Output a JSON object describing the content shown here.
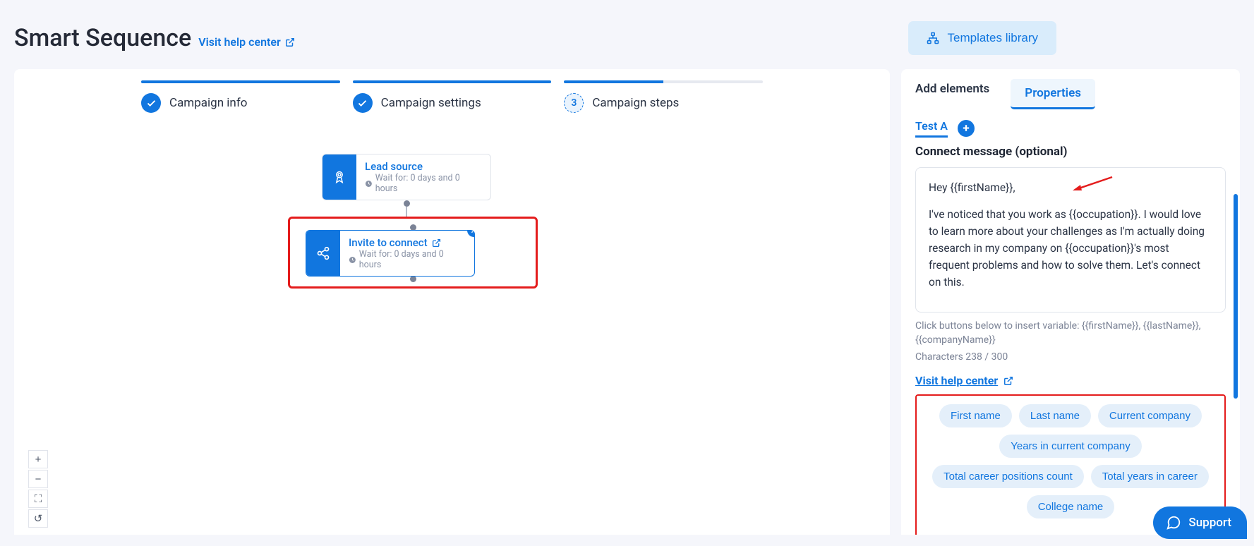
{
  "header": {
    "title": "Smart Sequence",
    "help_link": "Visit help center",
    "templates_button": "Templates library"
  },
  "steps": [
    {
      "label": "Campaign info",
      "state": "done"
    },
    {
      "label": "Campaign settings",
      "state": "done"
    },
    {
      "label": "Campaign steps",
      "state": "active",
      "number": "3"
    }
  ],
  "flow": {
    "node1": {
      "title": "Lead source",
      "sub": "Wait for: 0 days and 0 hours",
      "icon": "badge-icon"
    },
    "node2": {
      "title": "Invite to connect",
      "sub": "Wait for: 0 days and 0 hours",
      "icon": "share-icon"
    }
  },
  "zoom": {
    "in": "+",
    "out": "−",
    "fit": "⛶",
    "reset": "↺"
  },
  "panel": {
    "tabs": {
      "add": "Add elements",
      "properties": "Properties"
    },
    "test_label": "Test A",
    "section_title": "Connect message (optional)",
    "message_line1": "Hey {{firstName}},",
    "message_body": "I've noticed that you work as {{occupation}}. I would love to learn more about your challenges as I'm actually doing research in my company on {{occupation}}'s most frequent problems and how to solve them. Let's connect on this.",
    "hint": "Click buttons below to insert variable: {{firstName}}, {{lastName}}, {{companyName}}",
    "counter": "Characters 238 / 300",
    "help_link": "Visit help center",
    "chips": [
      "First name",
      "Last name",
      "Current company",
      "Years in current company",
      "Total career positions count",
      "Total years in career",
      "College name"
    ]
  },
  "support_label": "Support"
}
